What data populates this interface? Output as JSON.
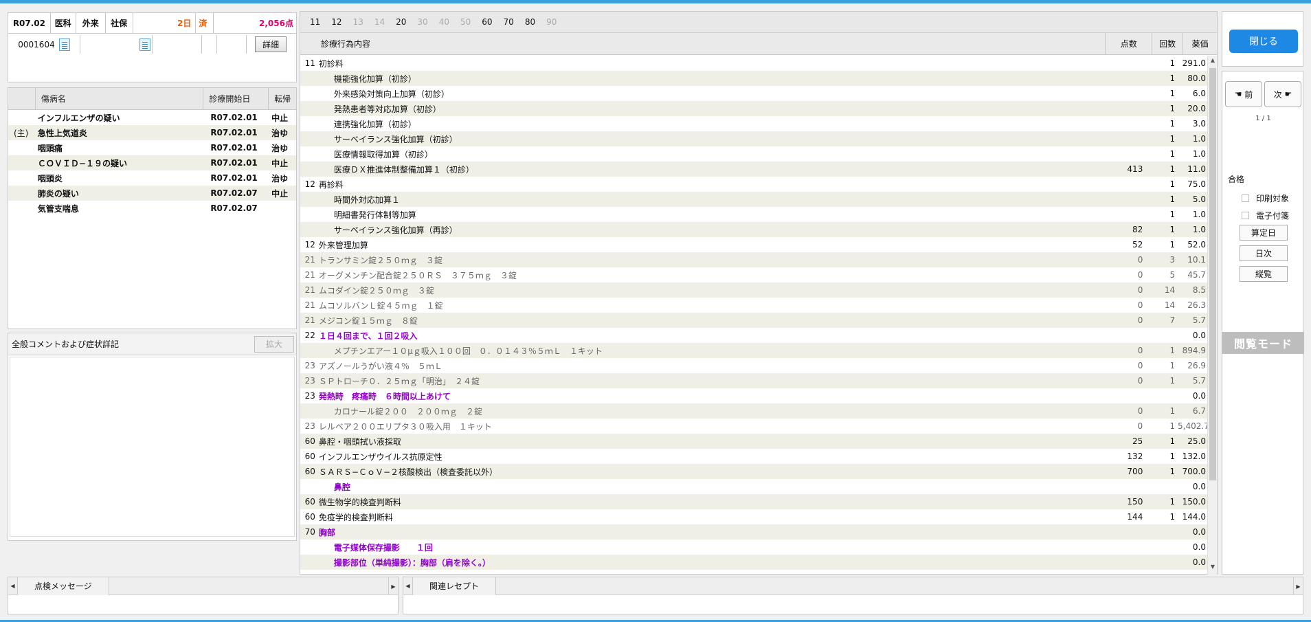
{
  "header": {
    "date": "R07.02",
    "type1": "医科",
    "type2": "外来",
    "type3": "社保",
    "days": "2日",
    "status": "済",
    "points": "2,056点",
    "patient_id": "0001604",
    "detail_label": "詳細"
  },
  "disease": {
    "col_name": "傷病名",
    "col_start": "診療開始日",
    "col_out": "転帰",
    "rows": [
      {
        "main": "",
        "name": "インフルエンザの疑い",
        "start": "R07.02.01",
        "out": "中止"
      },
      {
        "main": "(主)",
        "name": "急性上気道炎",
        "start": "R07.02.01",
        "out": "治ゆ"
      },
      {
        "main": "",
        "name": "咽頭痛",
        "start": "R07.02.01",
        "out": "治ゆ"
      },
      {
        "main": "",
        "name": "ＣＯＶＩＤ−１９の疑い",
        "start": "R07.02.01",
        "out": "中止"
      },
      {
        "main": "",
        "name": "咽頭炎",
        "start": "R07.02.01",
        "out": "治ゆ"
      },
      {
        "main": "",
        "name": "肺炎の疑い",
        "start": "R07.02.07",
        "out": "中止"
      },
      {
        "main": "",
        "name": "気管支喘息",
        "start": "R07.02.07",
        "out": ""
      }
    ]
  },
  "comment": {
    "title": "全般コメントおよび症状詳記",
    "expand_label": "拡大"
  },
  "main": {
    "tabs": [
      {
        "label": "11",
        "enabled": true
      },
      {
        "label": "12",
        "enabled": true
      },
      {
        "label": "13",
        "enabled": false
      },
      {
        "label": "14",
        "enabled": false
      },
      {
        "label": "20",
        "enabled": true
      },
      {
        "label": "30",
        "enabled": false
      },
      {
        "label": "40",
        "enabled": false
      },
      {
        "label": "50",
        "enabled": false
      },
      {
        "label": "60",
        "enabled": true
      },
      {
        "label": "70",
        "enabled": true
      },
      {
        "label": "80",
        "enabled": true
      },
      {
        "label": "90",
        "enabled": false
      }
    ],
    "col_content": "診療行為内容",
    "col_points": "点数",
    "col_count": "回数",
    "col_price": "薬価",
    "rows": [
      {
        "code": "11",
        "name": "初診料",
        "points": "",
        "count": "1",
        "price": "291.0",
        "style": "normal"
      },
      {
        "code": "",
        "name": "機能強化加算（初診）",
        "points": "",
        "count": "1",
        "price": "80.0",
        "style": "ind"
      },
      {
        "code": "",
        "name": "外来感染対策向上加算（初診）",
        "points": "",
        "count": "1",
        "price": "6.0",
        "style": "ind"
      },
      {
        "code": "",
        "name": "発熱患者等対応加算（初診）",
        "points": "",
        "count": "1",
        "price": "20.0",
        "style": "ind"
      },
      {
        "code": "",
        "name": "連携強化加算（初診）",
        "points": "",
        "count": "1",
        "price": "3.0",
        "style": "ind"
      },
      {
        "code": "",
        "name": "サーベイランス強化加算（初診）",
        "points": "",
        "count": "1",
        "price": "1.0",
        "style": "ind"
      },
      {
        "code": "",
        "name": "医療情報取得加算（初診）",
        "points": "",
        "count": "1",
        "price": "1.0",
        "style": "ind"
      },
      {
        "code": "",
        "name": "医療ＤＸ推進体制整備加算１（初診）",
        "points": "413",
        "count": "1",
        "price": "11.0",
        "style": "ind"
      },
      {
        "code": "12",
        "name": "再診料",
        "points": "",
        "count": "1",
        "price": "75.0",
        "style": "normal"
      },
      {
        "code": "",
        "name": "時間外対応加算１",
        "points": "",
        "count": "1",
        "price": "5.0",
        "style": "ind"
      },
      {
        "code": "",
        "name": "明細書発行体制等加算",
        "points": "",
        "count": "1",
        "price": "1.0",
        "style": "ind"
      },
      {
        "code": "",
        "name": "サーベイランス強化加算（再診）",
        "points": "82",
        "count": "1",
        "price": "1.0",
        "style": "ind"
      },
      {
        "code": "12",
        "name": "外来管理加算",
        "points": "52",
        "count": "1",
        "price": "52.0",
        "style": "normal"
      },
      {
        "code": "21",
        "name": "トランサミン錠２５０ｍｇ　３錠",
        "points": "0",
        "count": "3",
        "price": "10.1",
        "style": "gray"
      },
      {
        "code": "21",
        "name": "オーグメンチン配合錠２５０ＲＳ　３７５ｍｇ　３錠",
        "points": "0",
        "count": "5",
        "price": "45.7",
        "style": "gray"
      },
      {
        "code": "21",
        "name": "ムコダイン錠２５０ｍｇ　３錠",
        "points": "0",
        "count": "14",
        "price": "8.5",
        "style": "gray"
      },
      {
        "code": "21",
        "name": "ムコソルバンＬ錠４５ｍｇ　１錠",
        "points": "0",
        "count": "14",
        "price": "26.3",
        "style": "gray"
      },
      {
        "code": "21",
        "name": "メジコン錠１５ｍｇ　８錠",
        "points": "0",
        "count": "7",
        "price": "5.7",
        "style": "gray"
      },
      {
        "code": "22",
        "name": "１日４回まで、１回２吸入",
        "points": "",
        "count": "",
        "price": "0.0",
        "style": "purple"
      },
      {
        "code": "",
        "name": "メプチンエアー１０μｇ吸入１００回　０．０１４３％５ｍＬ　１キット",
        "points": "0",
        "count": "1",
        "price": "894.9",
        "style": "gray ind"
      },
      {
        "code": "23",
        "name": "アズノールうがい液４％　５ｍＬ",
        "points": "0",
        "count": "1",
        "price": "26.9",
        "style": "gray"
      },
      {
        "code": "23",
        "name": "ＳＰトローチ０．２５ｍｇ「明治」　２４錠",
        "points": "0",
        "count": "1",
        "price": "5.7",
        "style": "gray"
      },
      {
        "code": "23",
        "name": "発熱時　疼痛時　６時間以上あけて",
        "points": "",
        "count": "",
        "price": "0.0",
        "style": "purple"
      },
      {
        "code": "",
        "name": "カロナール錠２００　２００ｍｇ　２錠",
        "points": "0",
        "count": "1",
        "price": "6.7",
        "style": "gray ind"
      },
      {
        "code": "23",
        "name": "レルベア２００エリプタ３０吸入用　１キット",
        "points": "0",
        "count": "1",
        "price": "5,402.7",
        "style": "gray"
      },
      {
        "code": "60",
        "name": "鼻腔・咽頭拭い液採取",
        "points": "25",
        "count": "1",
        "price": "25.0",
        "style": "normal"
      },
      {
        "code": "60",
        "name": "インフルエンザウイルス抗原定性",
        "points": "132",
        "count": "1",
        "price": "132.0",
        "style": "normal"
      },
      {
        "code": "60",
        "name": "ＳＡＲＳ−ＣｏＶ−２核酸検出（検査委託以外）",
        "points": "700",
        "count": "1",
        "price": "700.0",
        "style": "normal"
      },
      {
        "code": "",
        "name": "鼻腔",
        "points": "",
        "count": "",
        "price": "0.0",
        "style": "purple ind"
      },
      {
        "code": "60",
        "name": "微生物学的検査判断料",
        "points": "150",
        "count": "1",
        "price": "150.0",
        "style": "normal"
      },
      {
        "code": "60",
        "name": "免疫学的検査判断料",
        "points": "144",
        "count": "1",
        "price": "144.0",
        "style": "normal"
      },
      {
        "code": "70",
        "name": "胸部",
        "points": "",
        "count": "",
        "price": "0.0",
        "style": "purple"
      },
      {
        "code": "",
        "name": "電子媒体保存撮影　　１回",
        "points": "",
        "count": "",
        "price": "0.0",
        "style": "purple ind"
      },
      {
        "code": "",
        "name": "撮影部位（単純撮影）：胸部（肩を除く。）",
        "points": "",
        "count": "",
        "price": "0.0",
        "style": "purple ind"
      }
    ]
  },
  "right": {
    "close_label": "閉じる",
    "prev_label": "前",
    "next_label": "次",
    "page": "1 / 1",
    "pass_label": "合格",
    "print_label": "印刷対象",
    "econ_label": "電子付箋",
    "calc_label": "算定日",
    "daily_label": "日次",
    "vertical_label": "縦覧",
    "mode_label": "閲覧モード"
  },
  "bottom": {
    "check_tab": "点検メッセージ",
    "related_tab": "関連レセプト"
  },
  "colors": {
    "accent": "#1e88e5",
    "purple": "#9400d3",
    "orange": "#f05a00",
    "pink": "#e0006a"
  }
}
